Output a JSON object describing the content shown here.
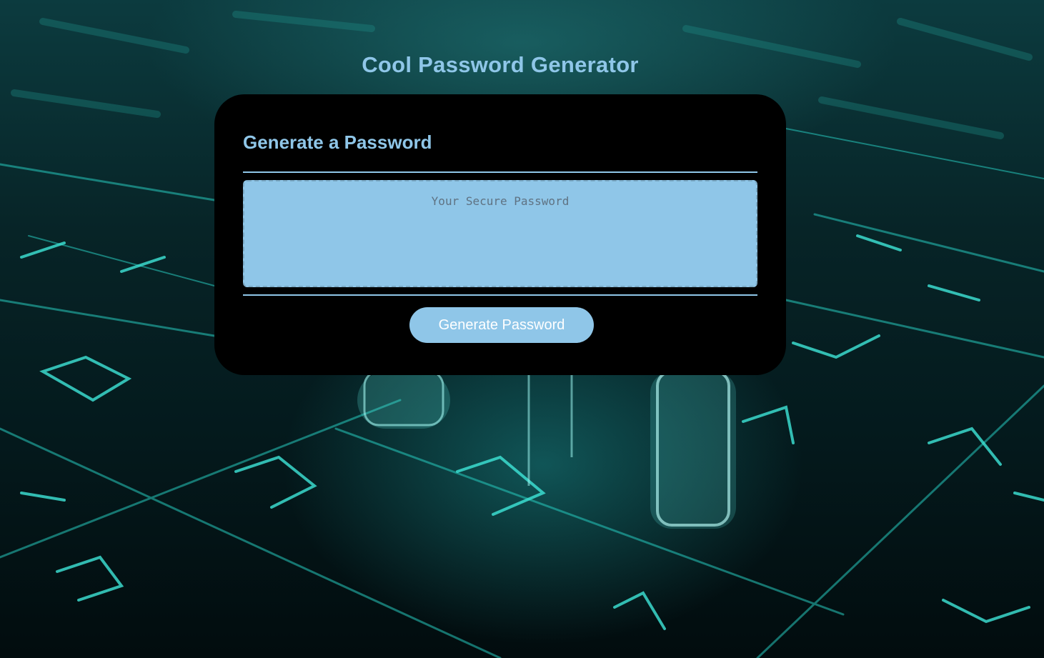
{
  "page": {
    "title": "Cool Password Generator"
  },
  "card": {
    "header": "Generate a Password",
    "password_placeholder": "Your Secure Password",
    "password_value": "",
    "generate_button_label": "Generate Password"
  },
  "colors": {
    "accent": "#8fc6e8",
    "card_background": "#000000",
    "glow": "#3ee6d8"
  }
}
